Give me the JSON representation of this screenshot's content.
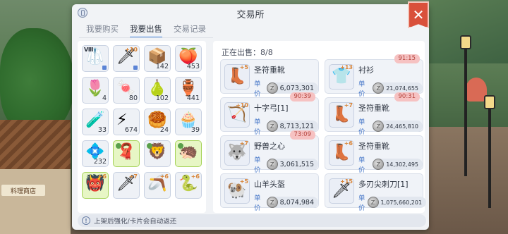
{
  "window": {
    "title": "交易所",
    "close_label": "✕"
  },
  "tabs": [
    {
      "label": "我要购买",
      "active": false
    },
    {
      "label": "我要出售",
      "active": true
    },
    {
      "label": "交易记录",
      "active": false
    }
  ],
  "background": {
    "shop_sign": "料理商店"
  },
  "inventory": [
    {
      "glyph": "🥼",
      "tagl": "Ⅷ",
      "qty": "",
      "style": "normal",
      "corner": true
    },
    {
      "glyph": "🗡",
      "tag": "+10",
      "qty": "",
      "style": "normal",
      "corner": true
    },
    {
      "glyph": "📦",
      "qty": "142",
      "style": "normal"
    },
    {
      "glyph": "🍑",
      "qty": "453",
      "style": "normal"
    },
    {
      "glyph": "🌷",
      "qty": "4",
      "style": "normal"
    },
    {
      "glyph": "🍬",
      "qty": "80",
      "style": "normal"
    },
    {
      "glyph": "🍐",
      "qty": "102",
      "style": "normal"
    },
    {
      "glyph": "🏺",
      "qty": "441",
      "style": "normal"
    },
    {
      "glyph": "🧪",
      "qty": "33",
      "style": "normal"
    },
    {
      "glyph": "⚡",
      "qty": "674",
      "style": "normal"
    },
    {
      "glyph": "🥮",
      "qty": "24",
      "style": "normal"
    },
    {
      "glyph": "🧁",
      "qty": "39",
      "style": "normal"
    },
    {
      "glyph": "💠",
      "qty": "232",
      "style": "normal"
    },
    {
      "glyph": "🧣",
      "qty": "",
      "style": "green",
      "lock": true
    },
    {
      "glyph": "🦁",
      "qty": "",
      "style": "normal",
      "lock": true
    },
    {
      "glyph": "🦔",
      "qty": "",
      "style": "green",
      "lock": true
    },
    {
      "glyph": "👹",
      "qty": "",
      "style": "green",
      "tag": "+6"
    },
    {
      "glyph": "🗡",
      "tag": "+7",
      "qty": "",
      "style": "normal"
    },
    {
      "glyph": "🪃",
      "tag": "+6",
      "qty": "",
      "style": "normal"
    },
    {
      "glyph": "🐍",
      "tag": "+6",
      "qty": "",
      "style": "normal"
    }
  ],
  "listings": {
    "header": "正在出售：8/8",
    "price_label": "单价",
    "items": [
      {
        "name": "圣符重靴",
        "price": "6,073,301",
        "timer": "",
        "glyph": "👢",
        "add": "+5"
      },
      {
        "name": "衬衫",
        "price": "21,074,655",
        "timer": "91:15",
        "glyph": "👕",
        "add": "+13",
        "small": true
      },
      {
        "name": "十字弓[1]",
        "price": "8,713,121",
        "timer": "90:39",
        "glyph": "🏹",
        "add": "+10"
      },
      {
        "name": "圣符重靴",
        "price": "24,465,810",
        "timer": "90:31",
        "glyph": "👢",
        "add": "+7",
        "small": true
      },
      {
        "name": "野兽之心",
        "price": "3,061,515",
        "timer": "73:09",
        "glyph": "🐺",
        "add": "+7"
      },
      {
        "name": "圣符重靴",
        "price": "14,302,495",
        "timer": "",
        "glyph": "👢",
        "add": "+6",
        "small": true
      },
      {
        "name": "山羊头盔",
        "price": "8,074,984",
        "timer": "",
        "glyph": "🐏",
        "add": "+5"
      },
      {
        "name": "多刃尖刺刀[1]",
        "price": "1,075,660,201",
        "timer": "",
        "glyph": "🗡",
        "add": "+15",
        "small": true
      }
    ]
  },
  "notice": "上架后强化/卡片会自动返还"
}
